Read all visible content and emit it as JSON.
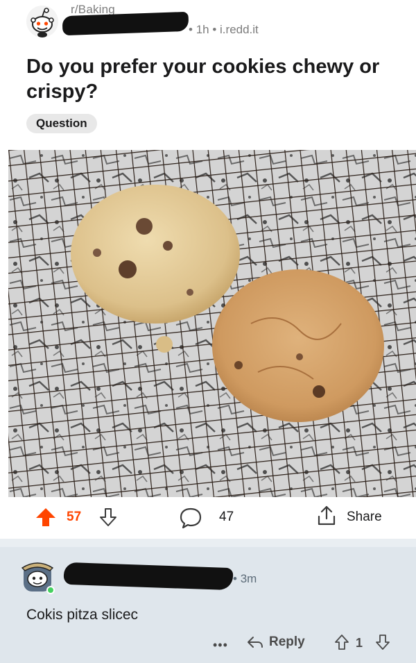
{
  "post": {
    "subreddit": "r/Baking",
    "time_ago": "1h",
    "domain": "i.redd.it",
    "meta_separator": "•",
    "title": "Do you prefer your cookies chewy or crispy?",
    "flair": "Question",
    "image_alt": "Two chocolate chip cookies on a cooling rack",
    "votes": "57",
    "comments": "47",
    "share_label": "Share"
  },
  "comment": {
    "time_ago": "3m",
    "text": "Cokis pitza slicec",
    "more_label": "•••",
    "reply_label": "Reply",
    "score": "1"
  },
  "colors": {
    "upvote_active": "#ff4500",
    "comment_bg": "#dfe6ec",
    "flair_bg": "#e8e8e8",
    "muted_text": "#7c7c7c"
  },
  "icons": {
    "subreddit_avatar": "snoo-icon",
    "upvote": "arrow-up-icon",
    "downvote": "arrow-down-icon",
    "comment": "comment-bubble-icon",
    "share": "share-icon",
    "reply": "reply-arrow-icon"
  }
}
